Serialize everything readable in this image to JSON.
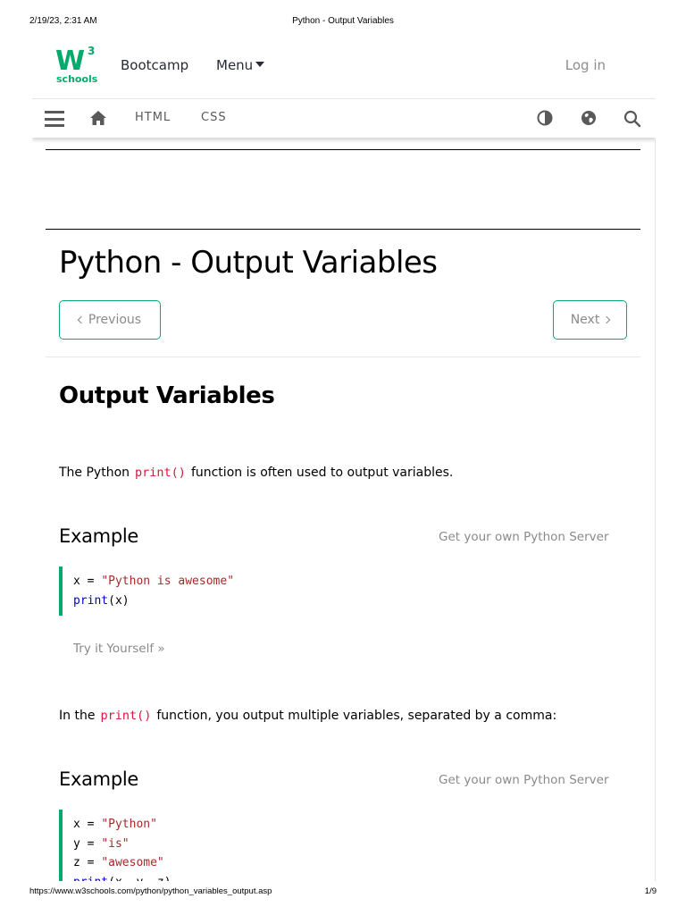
{
  "print_header": {
    "datetime": "2/19/23, 2:31 AM",
    "title": "Python - Output Variables"
  },
  "print_footer": {
    "url": "https://www.w3schools.com/python/python_variables_output.asp",
    "page": "1/9"
  },
  "topbar": {
    "logo_mark": "W",
    "logo_superscript": "3",
    "logo_text": "schools",
    "bootcamp": "Bootcamp",
    "menu": "Menu",
    "login": "Log in"
  },
  "subnav": {
    "html": "HTML",
    "css": "CSS",
    "icons": [
      "hamburger-icon",
      "home-icon",
      "contrast-icon",
      "globe-icon",
      "search-icon"
    ]
  },
  "main": {
    "title": "Python - Output Variables",
    "prev_label": "Previous",
    "next_label": "Next",
    "section_heading": "Output Variables",
    "para1": {
      "before": "The Python",
      "code": "print()",
      "after": "function is often used to output variables."
    },
    "example1": {
      "label": "Example",
      "server_link": "Get your own Python Server",
      "lines": [
        [
          {
            "t": "x = "
          },
          {
            "t": "\"Python is awesome\"",
            "k": "str"
          }
        ],
        [
          {
            "t": "print",
            "k": "fn"
          },
          {
            "t": "(x)"
          }
        ]
      ],
      "try_it": "Try it Yourself »"
    },
    "para2": {
      "before": "In the",
      "code": "print()",
      "after": "function, you output multiple variables, separated by a comma:"
    },
    "example2": {
      "label": "Example",
      "server_link": "Get your own Python Server",
      "lines": [
        [
          {
            "t": "x = "
          },
          {
            "t": "\"Python\"",
            "k": "str"
          }
        ],
        [
          {
            "t": "y = "
          },
          {
            "t": "\"is\"",
            "k": "str"
          }
        ],
        [
          {
            "t": "z = "
          },
          {
            "t": "\"awesome\"",
            "k": "str"
          }
        ],
        [
          {
            "t": "print",
            "k": "fn"
          },
          {
            "t": "(x, y, z)"
          }
        ]
      ]
    }
  },
  "colors": {
    "accent": "#04aa6d",
    "code_inline": "#dc143c",
    "code_string": "#a52a2a",
    "code_function": "#0000cd",
    "muted_text": "#8a8a8a"
  }
}
